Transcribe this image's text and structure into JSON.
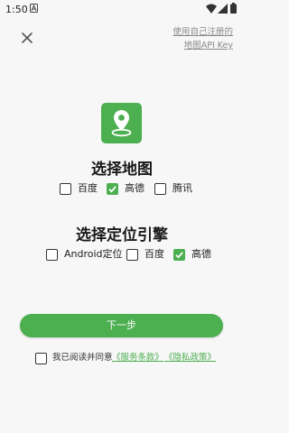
{
  "status_bar": {
    "time": "1:50"
  },
  "header": {
    "api_key_link_line1": "使用自己注册的",
    "api_key_link_line2": "地图API Key"
  },
  "map_section": {
    "title": "选择地图",
    "options": [
      {
        "label": "百度",
        "checked": false
      },
      {
        "label": "高德",
        "checked": true
      },
      {
        "label": "腾讯",
        "checked": false
      }
    ]
  },
  "location_section": {
    "title": "选择定位引擎",
    "options": [
      {
        "label": "Android定位",
        "checked": false
      },
      {
        "label": "百度",
        "checked": false
      },
      {
        "label": "高德",
        "checked": true
      }
    ]
  },
  "next_button": {
    "label": "下一步"
  },
  "agreement": {
    "checked": false,
    "text": "我已阅读并同意",
    "service_terms": "《服务条款》",
    "privacy_policy": "《隐私政策》"
  },
  "colors": {
    "accent": "#4caf50",
    "background": "#f7f7f7"
  }
}
